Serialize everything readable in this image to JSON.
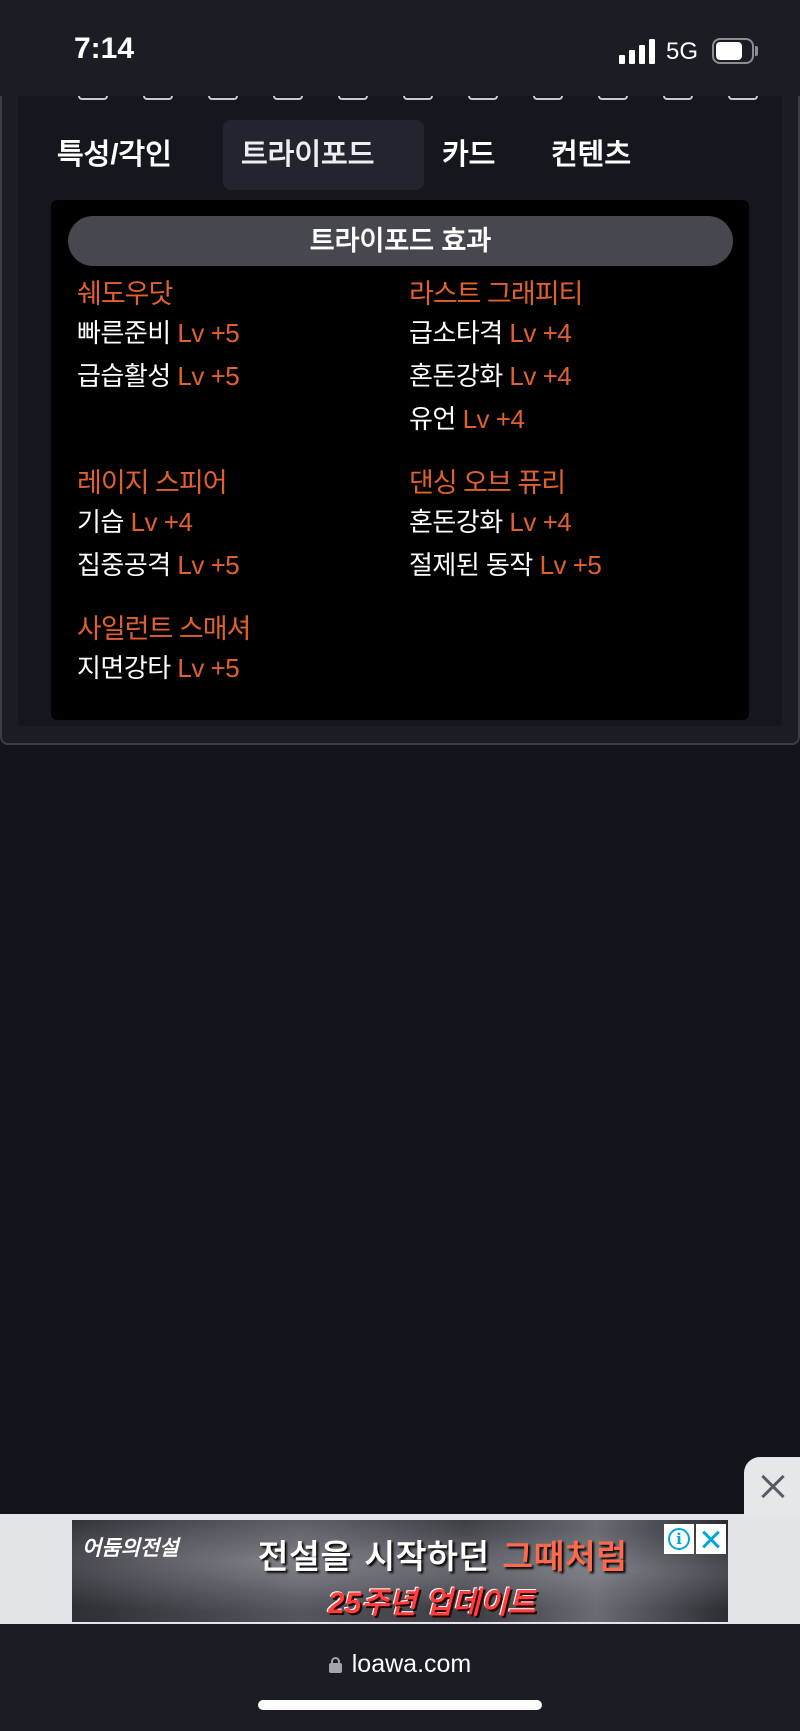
{
  "status_bar": {
    "time": "7:14",
    "network": "5G"
  },
  "tabs": [
    {
      "label": "특성/각인",
      "active": false
    },
    {
      "label": "트라이포드",
      "active": true
    },
    {
      "label": "카드",
      "active": false
    },
    {
      "label": "컨텐츠",
      "active": false
    }
  ],
  "tripod": {
    "title": "트라이포드 효과",
    "groups": [
      {
        "skill": "쉐도우닷",
        "traits": [
          {
            "name": "빠른준비",
            "level": "Lv +5"
          },
          {
            "name": "급습활성",
            "level": "Lv +5"
          }
        ]
      },
      {
        "skill": "라스트 그래피티",
        "traits": [
          {
            "name": "급소타격",
            "level": "Lv +4"
          },
          {
            "name": "혼돈강화",
            "level": "Lv +4"
          },
          {
            "name": "유언",
            "level": "Lv +4"
          }
        ]
      },
      {
        "skill": "레이지 스피어",
        "traits": [
          {
            "name": "기습",
            "level": "Lv +4"
          },
          {
            "name": "집중공격",
            "level": "Lv +5"
          }
        ]
      },
      {
        "skill": "댄싱 오브 퓨리",
        "traits": [
          {
            "name": "혼돈강화",
            "level": "Lv +4"
          },
          {
            "name": "절제된 동작",
            "level": "Lv +5"
          }
        ]
      },
      {
        "skill": "사일런트 스매셔",
        "traits": [
          {
            "name": "지면강타",
            "level": "Lv +5"
          }
        ]
      }
    ]
  },
  "ad": {
    "logo": "어둠의전설",
    "headline_part1": "전설을 시작하던 ",
    "headline_accent": "그때처럼",
    "subline": "25주년 업데이트"
  },
  "browser": {
    "url": "loawa.com"
  },
  "colors": {
    "accent": "#e0612e",
    "background": "#12141b",
    "panel": "#000000",
    "title_pill": "#46474f"
  }
}
